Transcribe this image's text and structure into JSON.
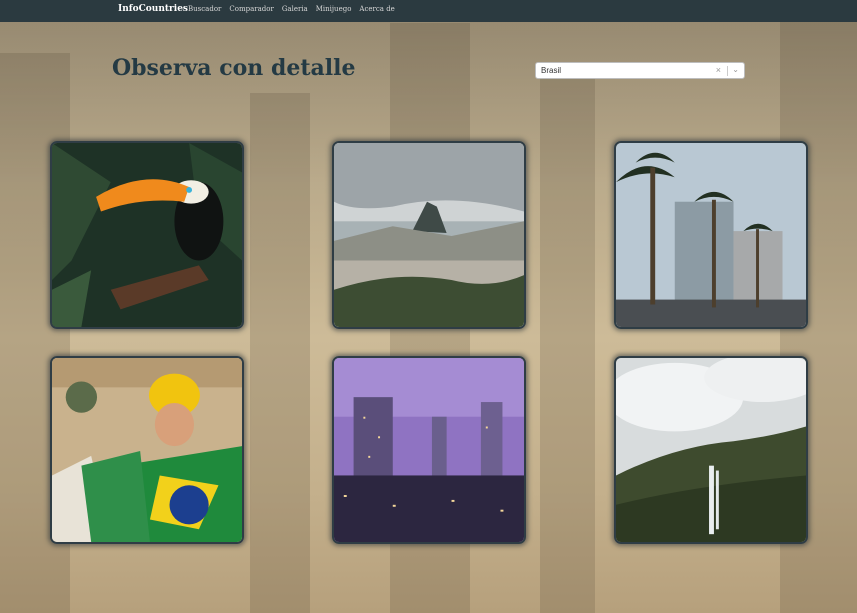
{
  "nav": {
    "brand": "InfoCountries",
    "links": [
      "Buscador",
      "Comparador",
      "Galeria",
      "Minijuego",
      "Acerca de"
    ]
  },
  "page": {
    "title": "Observa con detalle"
  },
  "country_select": {
    "value": "Brasil",
    "clear_icon": "close-icon",
    "dropdown_icon": "chevron-down-icon"
  },
  "gallery": [
    "toucan",
    "rio-de-janeiro-bay",
    "palm-tree-avenue",
    "fan-with-flag",
    "city-at-dusk",
    "waterfall-canyon"
  ]
}
